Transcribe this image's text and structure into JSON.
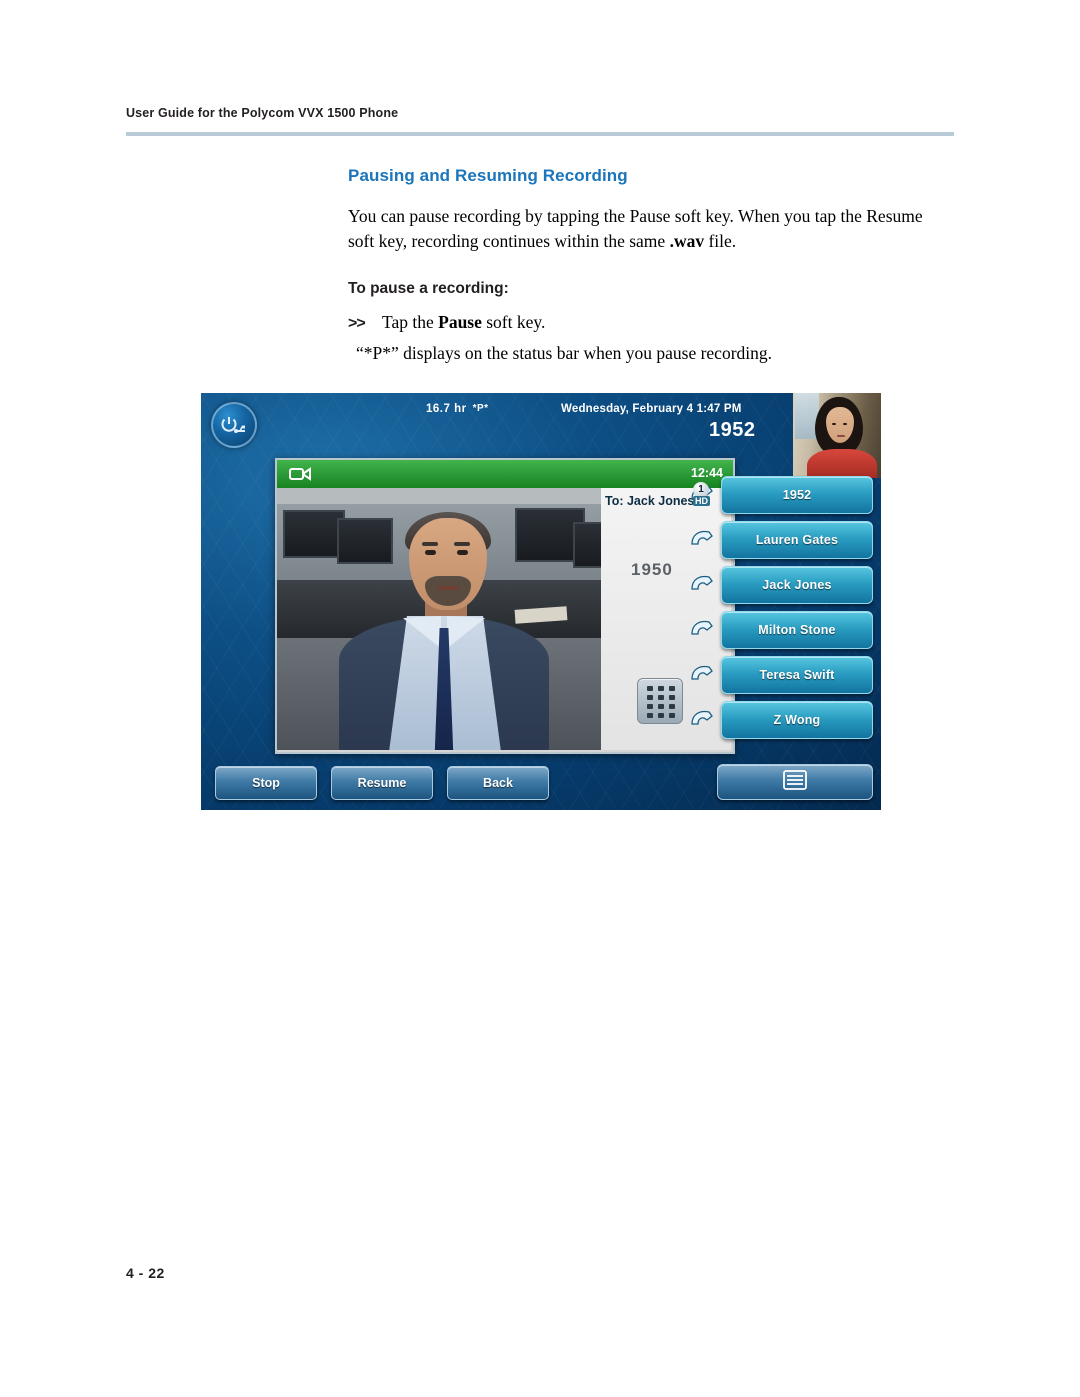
{
  "header": {
    "running_head": "User Guide for the Polycom VVX 1500 Phone"
  },
  "content": {
    "section_title": "Pausing and Resuming Recording",
    "intro_part1": "You can pause recording by tapping the Pause soft key. When you tap the Resume soft key, recording continues within the same ",
    "intro_bold": ".wav",
    "intro_part2": " file.",
    "sub_title": "To pause a recording:",
    "step_arrow": ">>",
    "step_text_pre": "Tap the ",
    "step_text_bold": "Pause",
    "step_text_post": " soft key.",
    "step_note": "“*P*” displays on the status bar when you pause recording."
  },
  "phone": {
    "status_bar": {
      "storage": "16.7 hr",
      "pause_indicator": "*P*",
      "datetime": "Wednesday, February 4  1:47 PM",
      "line_number": "1952"
    },
    "video_window": {
      "camera_icon": "video-camera-icon",
      "call_timer": "12:44",
      "to_label": "To: Jack Jones",
      "far_end_number": "1950",
      "keypad_icon": "keypad-icon"
    },
    "line_keys": [
      {
        "label": "1952",
        "badge": "1",
        "hd": "HD",
        "icon": "handset-icon"
      },
      {
        "label": "Lauren Gates",
        "icon": "handset-icon"
      },
      {
        "label": "Jack Jones",
        "icon": "handset-icon"
      },
      {
        "label": "Milton Stone",
        "icon": "handset-icon"
      },
      {
        "label": "Teresa Swift",
        "icon": "handset-icon"
      },
      {
        "label": "Z Wong",
        "icon": "handset-icon"
      }
    ],
    "soft_keys": [
      {
        "label": "Stop"
      },
      {
        "label": "Resume"
      },
      {
        "label": "Back"
      }
    ],
    "menu_key": {
      "icon": "menu-list-icon"
    },
    "power_key": {
      "icon": "power-usb-icon"
    }
  },
  "footer": {
    "page_number": "4 - 22"
  }
}
